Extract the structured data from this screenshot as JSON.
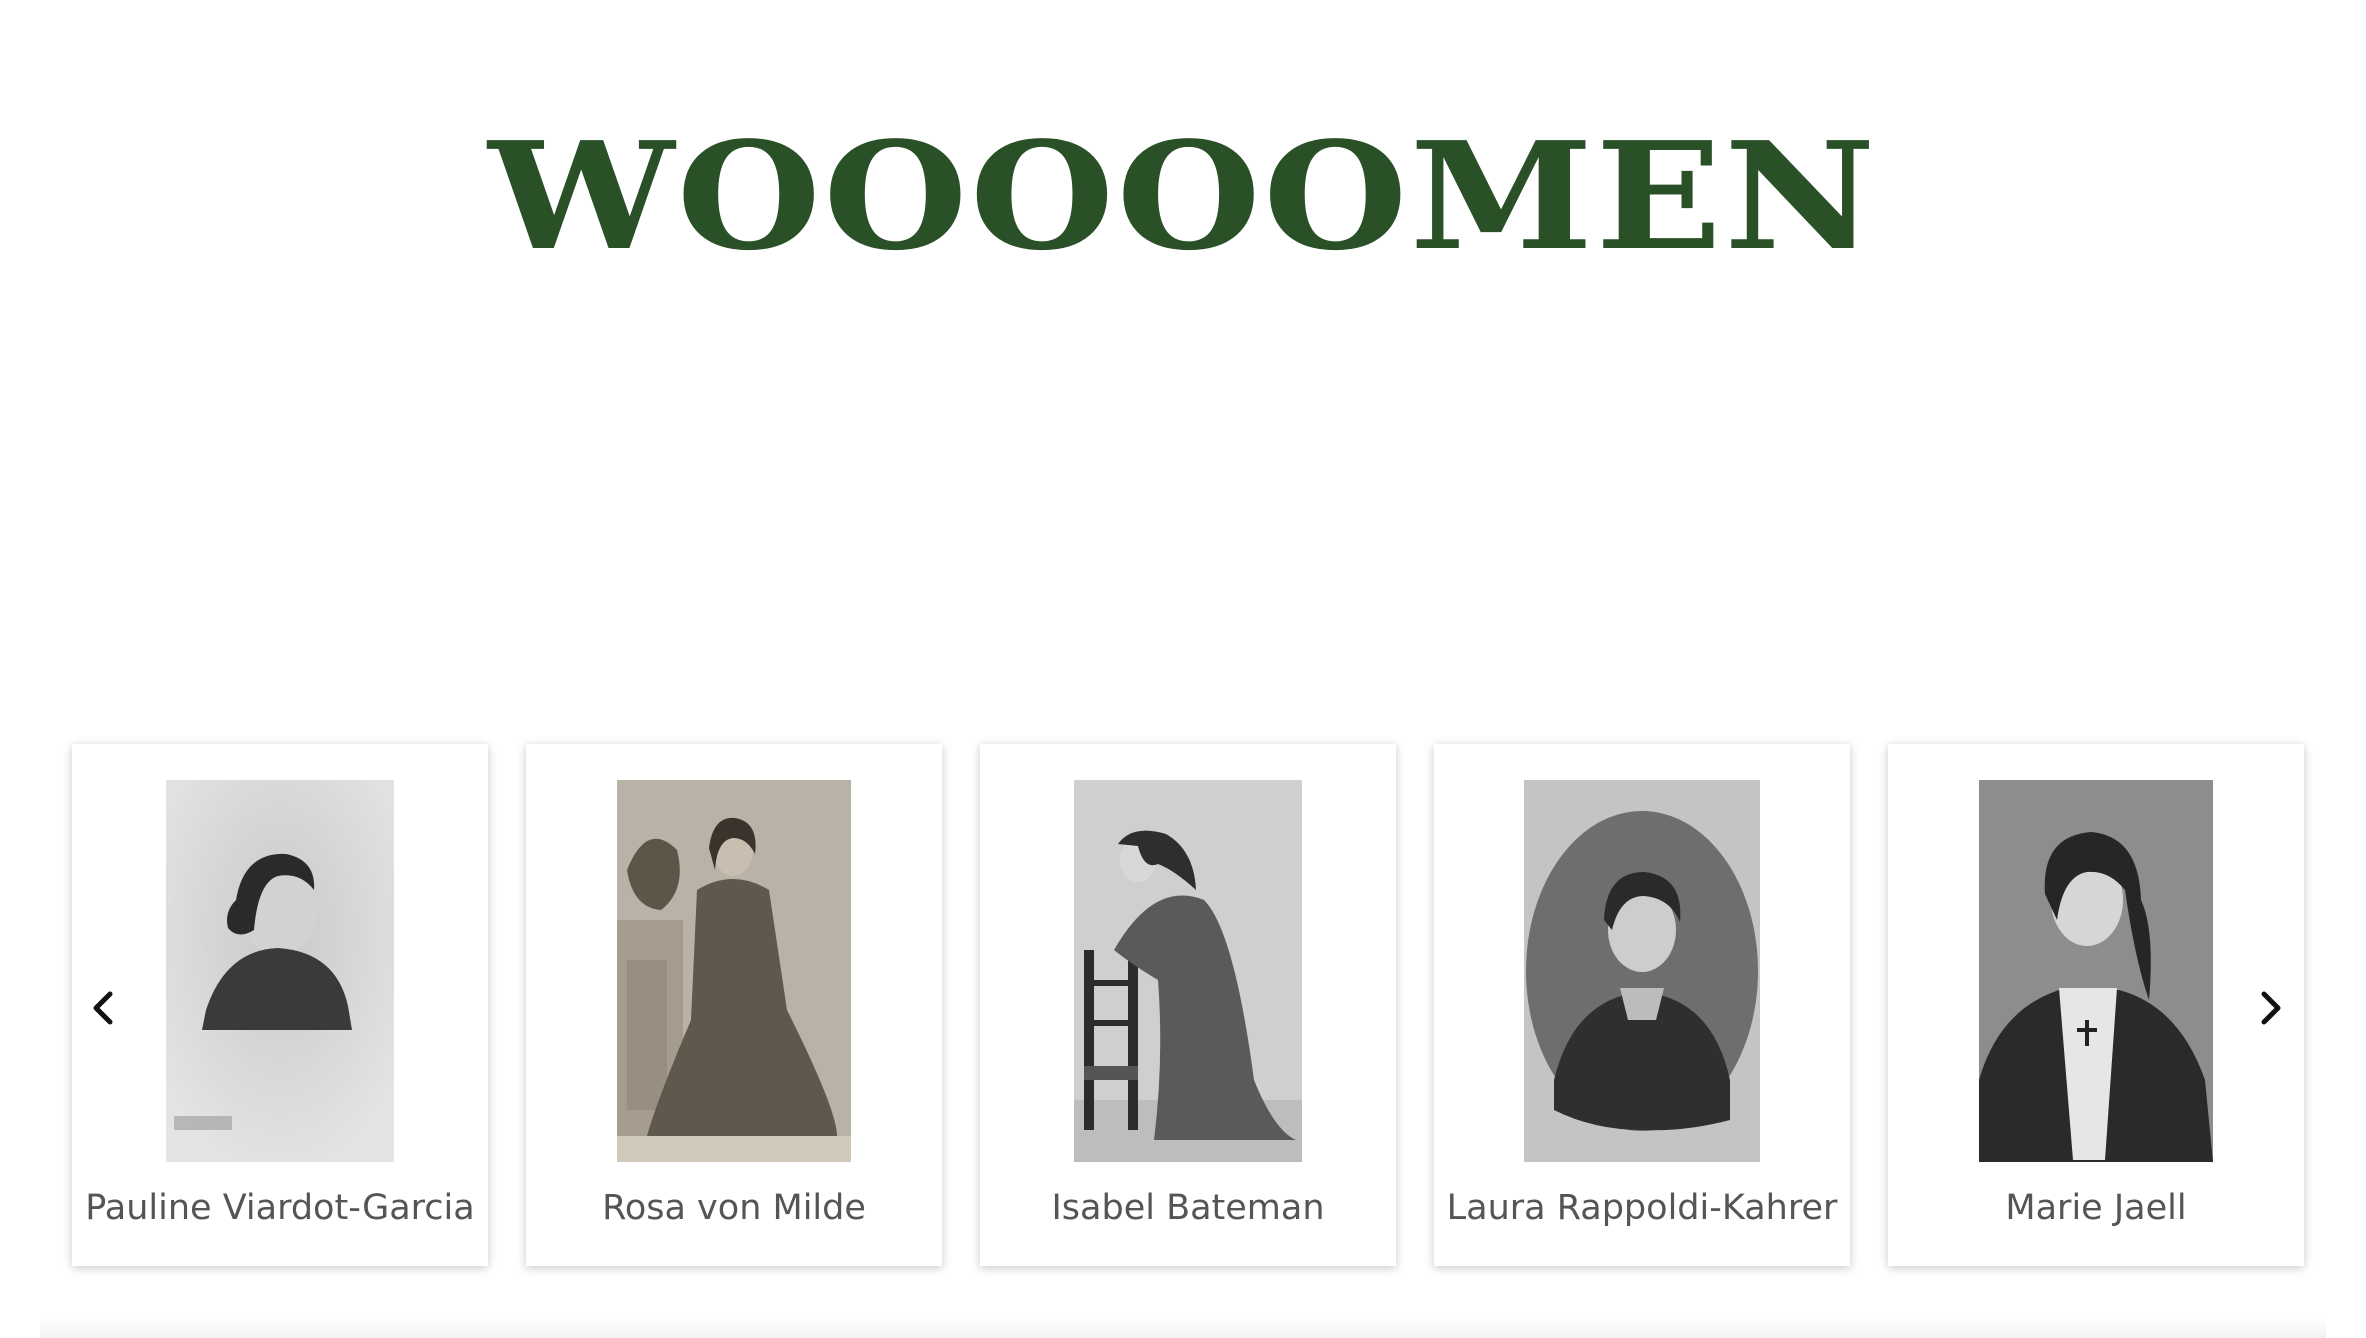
{
  "site": {
    "title": "WOOOOOMEN",
    "brand_color": "#2a5028"
  },
  "carousel": {
    "prev_icon": "chevron-left-icon",
    "next_icon": "chevron-right-icon",
    "cards": [
      {
        "name": "Pauline Viardot-Garcia"
      },
      {
        "name": "Rosa von Milde"
      },
      {
        "name": "Isabel Bateman"
      },
      {
        "name": "Laura Rappoldi-Kahrer"
      },
      {
        "name": "Marie Jaell"
      }
    ]
  }
}
